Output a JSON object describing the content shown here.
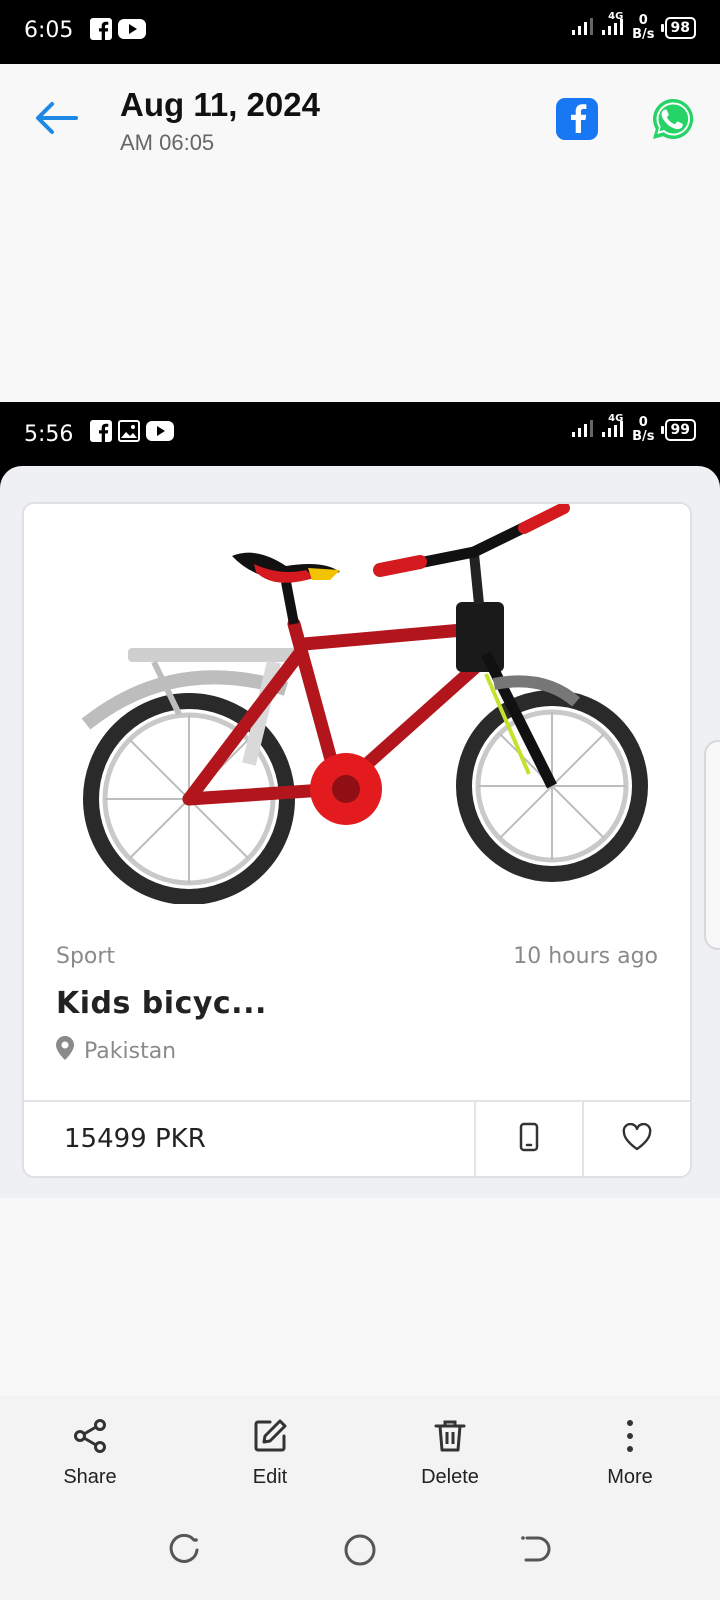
{
  "status_bar": {
    "time": "6:05",
    "network": "4G",
    "speed_value": "0",
    "speed_unit": "B/s",
    "battery": "98"
  },
  "viewer": {
    "date": "Aug 11, 2024",
    "time": "AM 06:05"
  },
  "inner_status_bar": {
    "time": "5:56",
    "network": "4G",
    "speed_value": "0",
    "speed_unit": "B/s",
    "battery": "99"
  },
  "listing": {
    "category": "Sport",
    "posted": "10 hours ago",
    "title": "Kids bicyc...",
    "location": "Pakistan",
    "price": "15499 PKR"
  },
  "actions": {
    "share": "Share",
    "edit": "Edit",
    "delete": "Delete",
    "more": "More"
  },
  "colors": {
    "accent_blue": "#1e88e5",
    "facebook": "#1877f2",
    "whatsapp": "#25d366",
    "bike_red": "#c4161c"
  }
}
